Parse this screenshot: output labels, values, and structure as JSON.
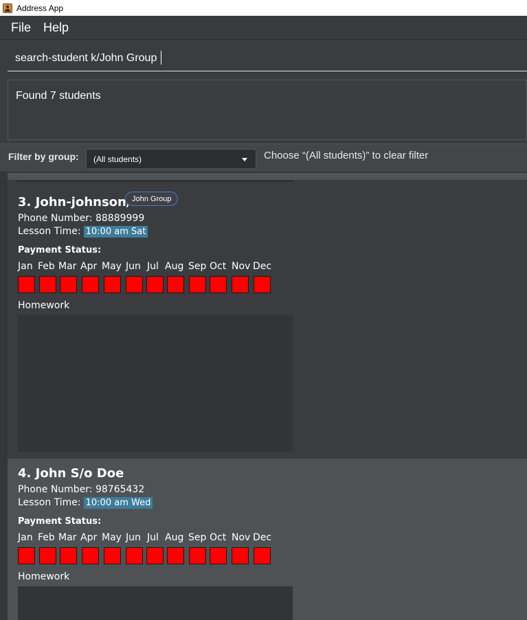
{
  "window": {
    "title": "Address App"
  },
  "menu": {
    "items": [
      "File",
      "Help"
    ]
  },
  "command": {
    "value": "search-student k/John Group"
  },
  "result": {
    "text": "Found 7 students"
  },
  "filter": {
    "label": "Filter by group:",
    "selected": "(All students)",
    "hint": "Choose “(All students)” to clear filter"
  },
  "months": [
    "Jan",
    "Feb",
    "Mar",
    "Apr",
    "May",
    "Jun",
    "Jul",
    "Aug",
    "Sep",
    "Oct",
    "Nov",
    "Dec"
  ],
  "students": [
    {
      "name": "3. John-johnson/",
      "tag": "John Group",
      "phone_label": "Phone Number:",
      "phone": "88889999",
      "lesson_label": "Lesson Time:",
      "lesson": "10:00 am Sat",
      "payment_label": "Payment Status:",
      "payment_status": [
        "unpaid",
        "unpaid",
        "unpaid",
        "unpaid",
        "unpaid",
        "unpaid",
        "unpaid",
        "unpaid",
        "unpaid",
        "unpaid",
        "unpaid",
        "unpaid"
      ],
      "payment_color": "#ff0000",
      "homework_label": "Homework"
    },
    {
      "name": "4. John S/o Doe",
      "phone_label": "Phone Number:",
      "phone": "98765432",
      "lesson_label": "Lesson Time:",
      "lesson": "10:00 am Wed",
      "payment_label": "Payment Status:",
      "payment_status": [
        "unpaid",
        "unpaid",
        "unpaid",
        "unpaid",
        "unpaid",
        "unpaid",
        "unpaid",
        "unpaid",
        "unpaid",
        "unpaid",
        "unpaid",
        "unpaid"
      ],
      "payment_color": "#ff0000",
      "homework_label": "Homework"
    }
  ],
  "colors": {
    "accent_tag_border": "#4f78c8",
    "lesson_badge": "#3e7d99",
    "unpaid": "#ff0000",
    "background": "#3b3e40"
  }
}
